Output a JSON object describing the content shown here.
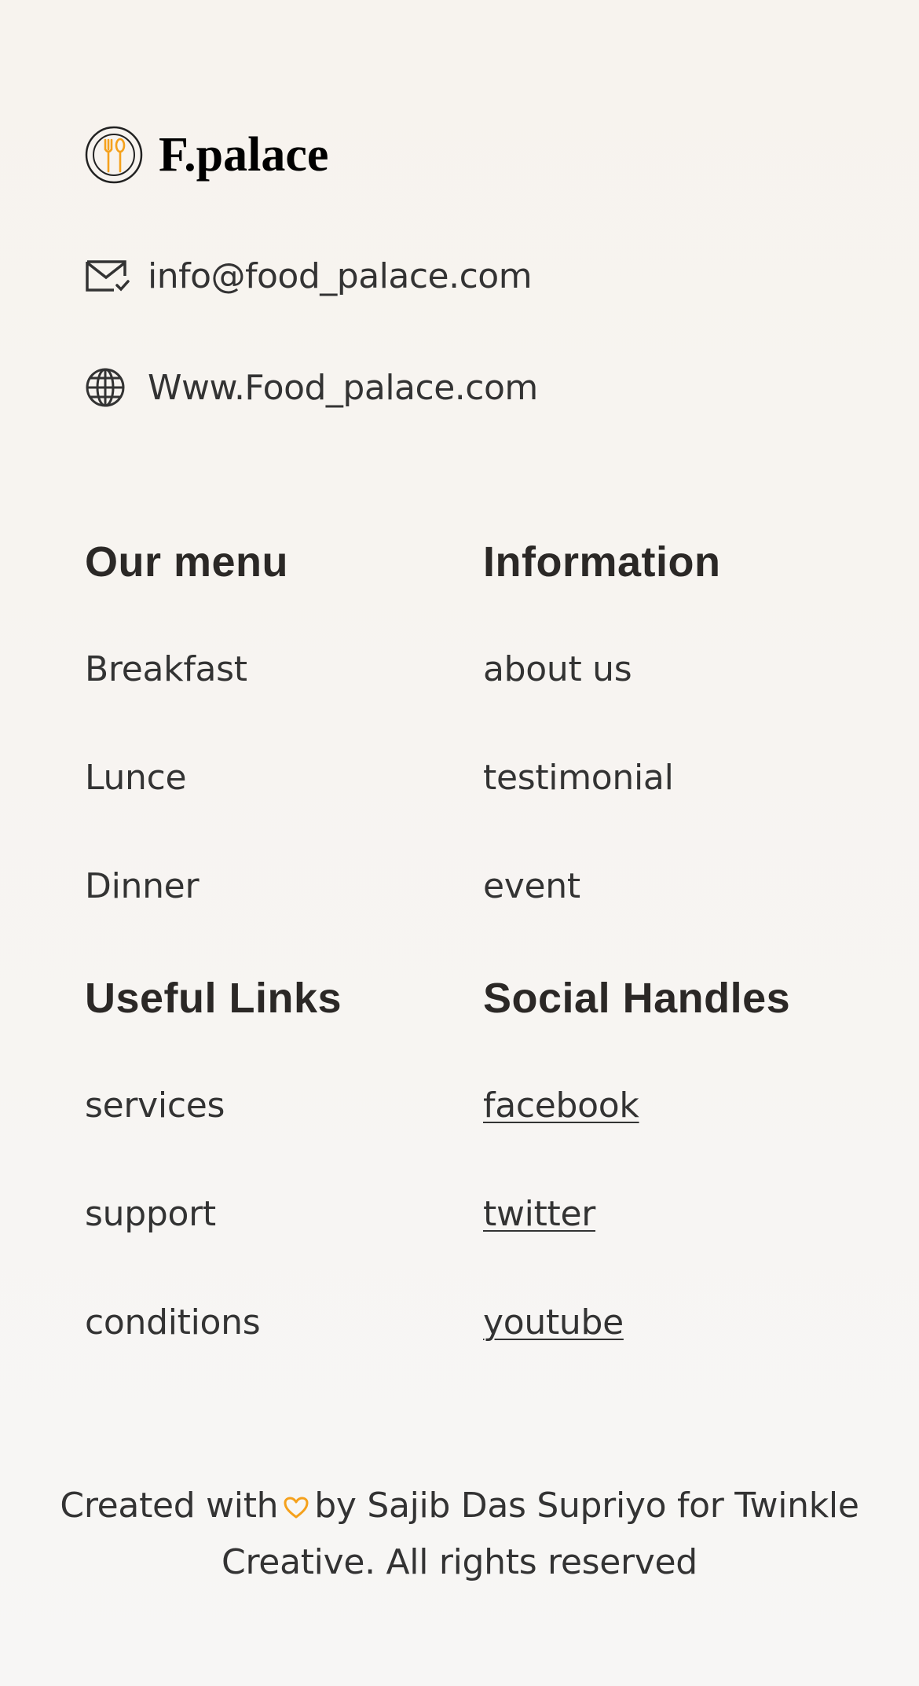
{
  "brand": {
    "name": "F.palace",
    "logo_icon": "fork-spoon-plate-icon",
    "accent": "#f5a11b"
  },
  "contact": {
    "email": {
      "icon": "mail-check-icon",
      "text": "info@food_palace.com"
    },
    "website": {
      "icon": "globe-icon",
      "text": "Www.Food_palace.com"
    }
  },
  "sections": {
    "menu": {
      "title": "Our menu",
      "items": [
        "Breakfast",
        "Lunce",
        "Dinner"
      ]
    },
    "information": {
      "title": "Information",
      "items": [
        "about us",
        "testimonial",
        "event"
      ]
    },
    "useful_links": {
      "title": "Useful Links",
      "items": [
        "services",
        "support",
        "conditions"
      ]
    },
    "social": {
      "title": "Social Handles",
      "items": [
        "facebook",
        "twitter",
        "youtube"
      ]
    }
  },
  "footer": {
    "before": "Created with",
    "heart_icon": "heart-icon",
    "after": "by Sajib Das Supriyo for Twinkle Creative. All rights reserved"
  }
}
